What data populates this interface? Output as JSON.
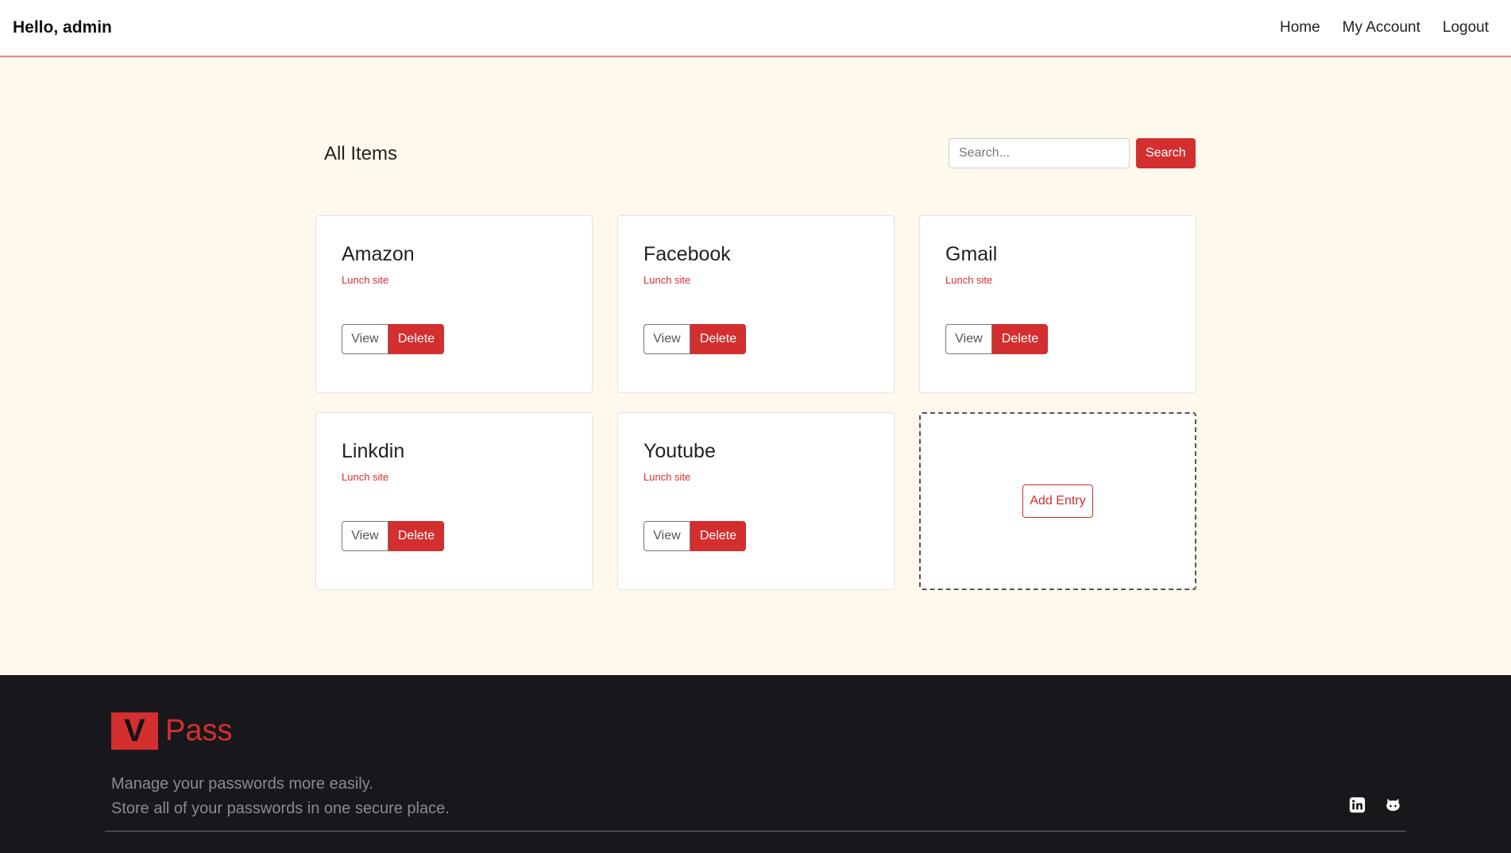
{
  "navbar": {
    "greeting": "Hello, admin",
    "links": [
      "Home",
      "My Account",
      "Logout"
    ]
  },
  "main": {
    "title": "All Items",
    "search": {
      "placeholder": "Search...",
      "button_label": "Search"
    },
    "items": [
      {
        "title": "Amazon",
        "subtitle": "Lunch site",
        "view_label": "View",
        "delete_label": "Delete"
      },
      {
        "title": "Facebook",
        "subtitle": "Lunch site",
        "view_label": "View",
        "delete_label": "Delete"
      },
      {
        "title": "Gmail",
        "subtitle": "Lunch site",
        "view_label": "View",
        "delete_label": "Delete"
      },
      {
        "title": "Linkdin",
        "subtitle": "Lunch site",
        "view_label": "View",
        "delete_label": "Delete"
      },
      {
        "title": "Youtube",
        "subtitle": "Lunch site",
        "view_label": "View",
        "delete_label": "Delete"
      }
    ],
    "add_entry_label": "Add Entry"
  },
  "footer": {
    "logo_mark": "V",
    "logo_text": "Pass",
    "tagline_1": "Manage your passwords more easily.",
    "tagline_2": "Store all of your passwords in one secure place.",
    "social_icons": [
      "linkedin-icon",
      "github-icon"
    ]
  },
  "colors": {
    "accent": "#d32f2f",
    "page_bg": "#fff8ec",
    "footer_bg": "#18171c",
    "nav_border": "#e8838f"
  }
}
